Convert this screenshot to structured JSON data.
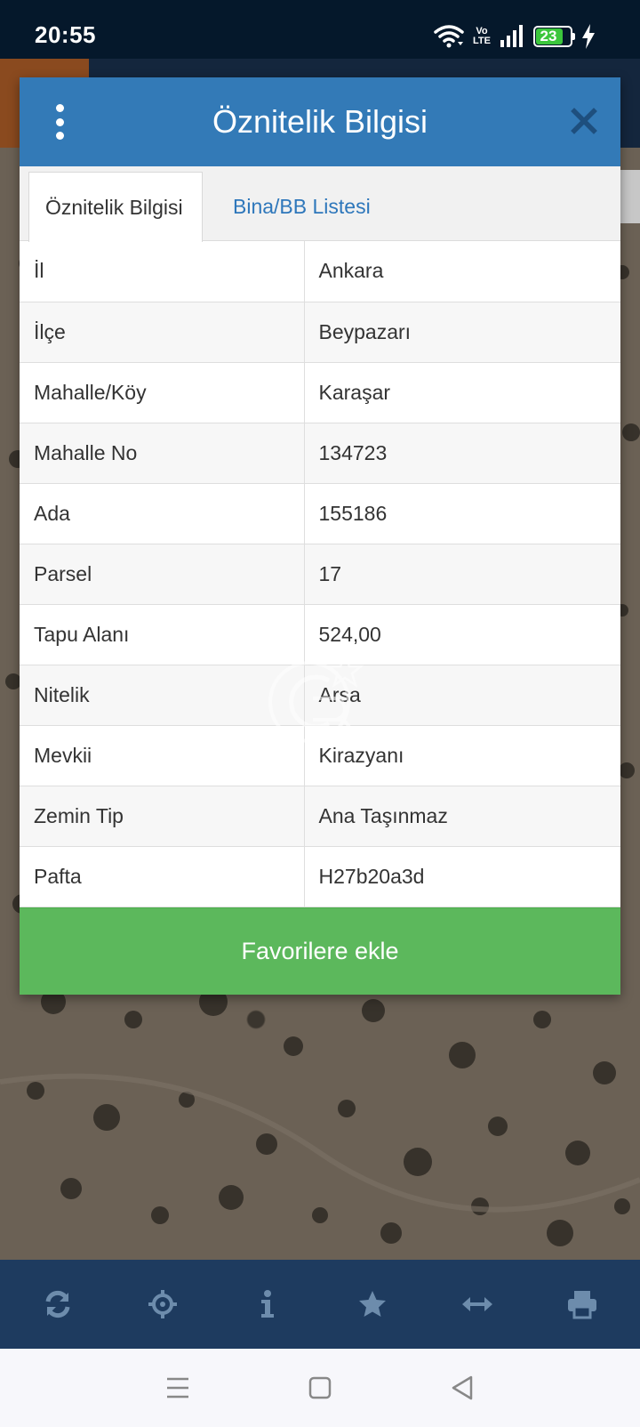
{
  "status": {
    "time": "20:55",
    "volte_top": "Vo",
    "volte_bottom": "LTE",
    "battery": "23"
  },
  "dialog": {
    "title": "Öznitelik Bilgisi",
    "tabs": [
      {
        "label": "Öznitelik Bilgisi",
        "active": true
      },
      {
        "label": "Bina/BB Listesi",
        "active": false
      }
    ],
    "rows": [
      {
        "key": "İl",
        "value": "Ankara"
      },
      {
        "key": "İlçe",
        "value": "Beypazarı"
      },
      {
        "key": "Mahalle/Köy",
        "value": "Karaşar"
      },
      {
        "key": "Mahalle No",
        "value": "134723"
      },
      {
        "key": "Ada",
        "value": "155186"
      },
      {
        "key": "Parsel",
        "value": "17"
      },
      {
        "key": "Tapu Alanı",
        "value": "524,00"
      },
      {
        "key": "Nitelik",
        "value": "Arsa"
      },
      {
        "key": "Mevkii",
        "value": "Kirazyanı"
      },
      {
        "key": "Zemin Tip",
        "value": "Ana Taşınmaz"
      },
      {
        "key": "Pafta",
        "value": "H27b20a3d"
      }
    ],
    "favorite_button": "Favorilere ekle"
  },
  "toolbar": {
    "icons": [
      "refresh-icon",
      "crosshair-icon",
      "info-icon",
      "star-icon",
      "measure-icon",
      "print-icon"
    ]
  },
  "navbar": {
    "icons": [
      "menu-icon",
      "home-icon",
      "back-icon"
    ]
  },
  "colors": {
    "header": "#337ab7",
    "favorite": "#5cb85c",
    "toolbar": "#1e3b5f",
    "link": "#2e77bb"
  }
}
